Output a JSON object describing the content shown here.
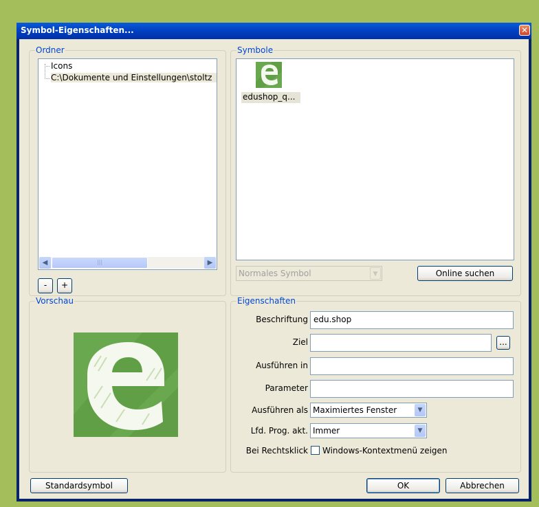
{
  "window": {
    "title": "Symbol-Eigenschaften...",
    "close_glyph": "✕"
  },
  "ordner": {
    "title": "Ordner",
    "tree": [
      "Icons",
      "C:\\Dokumente und Einstellungen\\stoltz"
    ],
    "remove_label": "-",
    "add_label": "+",
    "scroll_thumb_glyph": "|||"
  },
  "symbole": {
    "title": "Symbole",
    "items": [
      {
        "label": "edushop_q...",
        "icon": "edushop-icon"
      }
    ],
    "type_select": "Normales Symbol",
    "online_button": "Online suchen"
  },
  "vorschau": {
    "title": "Vorschau"
  },
  "eigenschaften": {
    "title": "Eigenschaften",
    "beschriftung_label": "Beschriftung",
    "beschriftung_value": "edu.shop",
    "ziel_label": "Ziel",
    "ziel_value": "",
    "browse_label": "...",
    "ausfuehren_in_label": "Ausführen in",
    "ausfuehren_in_value": "",
    "parameter_label": "Parameter",
    "parameter_value": "",
    "ausfuehren_als_label": "Ausführen als",
    "ausfuehren_als_value": "Maximiertes Fenster",
    "lfd_label": "Lfd. Prog. akt.",
    "lfd_value": "Immer",
    "rechtsklick_label": "Bei Rechtsklick",
    "rechtsklick_checkbox": "Windows-Kontextmenü zeigen",
    "rechtsklick_checked": false
  },
  "footer": {
    "standard_button": "Standardsymbol",
    "ok_button": "OK",
    "cancel_button": "Abbrechen"
  },
  "colors": {
    "background": "#a4be5c",
    "titlebar": "#0040c0",
    "groupTitle": "#0046d5",
    "iconGreen": "#6aa84f"
  }
}
